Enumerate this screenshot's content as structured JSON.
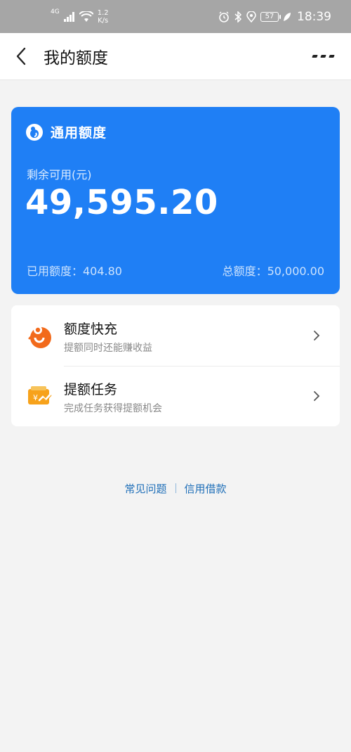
{
  "status_bar": {
    "network": "4G",
    "speed_value": "1.2",
    "speed_unit": "K/s",
    "battery": "57",
    "time": "18:39"
  },
  "header": {
    "title": "我的额度"
  },
  "quota_card": {
    "title": "通用额度",
    "remaining_label": "剩余可用(元)",
    "remaining_amount": "49,595.20",
    "used": "已用额度：404.80",
    "total": "总额度：50,000.00",
    "color": "#1f7ff5"
  },
  "list": {
    "items": [
      {
        "title": "额度快充",
        "subtitle": "提额同时还能赚收益",
        "icon": "fast-charge-icon"
      },
      {
        "title": "提额任务",
        "subtitle": "完成任务获得提额机会",
        "icon": "task-wallet-icon"
      }
    ]
  },
  "footer": {
    "faq": "常见问题",
    "loan": "信用借款"
  }
}
